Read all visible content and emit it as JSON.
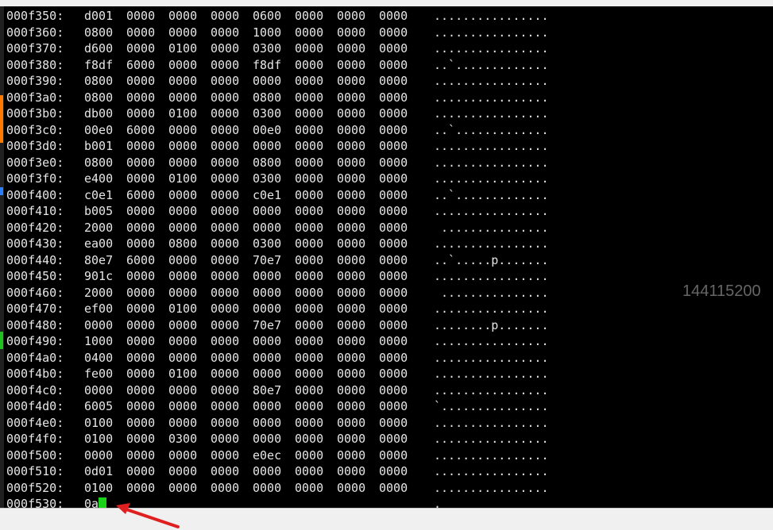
{
  "colors": {
    "background": "#000000",
    "text": "#e6e6e6",
    "cursor": "#19d219",
    "arrow": "#e02020",
    "side_value": "#666666"
  },
  "hexdump": {
    "rows": [
      {
        "addr": "000f350:",
        "hex": [
          "d001",
          "0000",
          "0000",
          "0000",
          "0600",
          "0000",
          "0000",
          "0000"
        ],
        "ascii": "................"
      },
      {
        "addr": "000f360:",
        "hex": [
          "0800",
          "0000",
          "0000",
          "0000",
          "1000",
          "0000",
          "0000",
          "0000"
        ],
        "ascii": "................"
      },
      {
        "addr": "000f370:",
        "hex": [
          "d600",
          "0000",
          "0100",
          "0000",
          "0300",
          "0000",
          "0000",
          "0000"
        ],
        "ascii": "................"
      },
      {
        "addr": "000f380:",
        "hex": [
          "f8df",
          "6000",
          "0000",
          "0000",
          "f8df",
          "0000",
          "0000",
          "0000"
        ],
        "ascii": "..`............."
      },
      {
        "addr": "000f390:",
        "hex": [
          "0800",
          "0000",
          "0000",
          "0000",
          "0000",
          "0000",
          "0000",
          "0000"
        ],
        "ascii": "................"
      },
      {
        "addr": "000f3a0:",
        "hex": [
          "0800",
          "0000",
          "0000",
          "0000",
          "0800",
          "0000",
          "0000",
          "0000"
        ],
        "ascii": "................"
      },
      {
        "addr": "000f3b0:",
        "hex": [
          "db00",
          "0000",
          "0100",
          "0000",
          "0300",
          "0000",
          "0000",
          "0000"
        ],
        "ascii": "................"
      },
      {
        "addr": "000f3c0:",
        "hex": [
          "00e0",
          "6000",
          "0000",
          "0000",
          "00e0",
          "0000",
          "0000",
          "0000"
        ],
        "ascii": "..`............."
      },
      {
        "addr": "000f3d0:",
        "hex": [
          "b001",
          "0000",
          "0000",
          "0000",
          "0000",
          "0000",
          "0000",
          "0000"
        ],
        "ascii": "................"
      },
      {
        "addr": "000f3e0:",
        "hex": [
          "0800",
          "0000",
          "0000",
          "0000",
          "0800",
          "0000",
          "0000",
          "0000"
        ],
        "ascii": "................"
      },
      {
        "addr": "000f3f0:",
        "hex": [
          "e400",
          "0000",
          "0100",
          "0000",
          "0300",
          "0000",
          "0000",
          "0000"
        ],
        "ascii": "................"
      },
      {
        "addr": "000f400:",
        "hex": [
          "c0e1",
          "6000",
          "0000",
          "0000",
          "c0e1",
          "0000",
          "0000",
          "0000"
        ],
        "ascii": "..`............."
      },
      {
        "addr": "000f410:",
        "hex": [
          "b005",
          "0000",
          "0000",
          "0000",
          "0000",
          "0000",
          "0000",
          "0000"
        ],
        "ascii": "................"
      },
      {
        "addr": "000f420:",
        "hex": [
          "2000",
          "0000",
          "0000",
          "0000",
          "0000",
          "0000",
          "0000",
          "0000"
        ],
        "ascii": " ..............."
      },
      {
        "addr": "000f430:",
        "hex": [
          "ea00",
          "0000",
          "0800",
          "0000",
          "0300",
          "0000",
          "0000",
          "0000"
        ],
        "ascii": "................"
      },
      {
        "addr": "000f440:",
        "hex": [
          "80e7",
          "6000",
          "0000",
          "0000",
          "70e7",
          "0000",
          "0000",
          "0000"
        ],
        "ascii": "..`.....p......."
      },
      {
        "addr": "000f450:",
        "hex": [
          "901c",
          "0000",
          "0000",
          "0000",
          "0000",
          "0000",
          "0000",
          "0000"
        ],
        "ascii": "................"
      },
      {
        "addr": "000f460:",
        "hex": [
          "2000",
          "0000",
          "0000",
          "0000",
          "0000",
          "0000",
          "0000",
          "0000"
        ],
        "ascii": " ..............."
      },
      {
        "addr": "000f470:",
        "hex": [
          "ef00",
          "0000",
          "0100",
          "0000",
          "0000",
          "0000",
          "0000",
          "0000"
        ],
        "ascii": "................"
      },
      {
        "addr": "000f480:",
        "hex": [
          "0000",
          "0000",
          "0000",
          "0000",
          "70e7",
          "0000",
          "0000",
          "0000"
        ],
        "ascii": "........p......."
      },
      {
        "addr": "000f490:",
        "hex": [
          "1000",
          "0000",
          "0000",
          "0000",
          "0000",
          "0000",
          "0000",
          "0000"
        ],
        "ascii": "................"
      },
      {
        "addr": "000f4a0:",
        "hex": [
          "0400",
          "0000",
          "0000",
          "0000",
          "0000",
          "0000",
          "0000",
          "0000"
        ],
        "ascii": "................"
      },
      {
        "addr": "000f4b0:",
        "hex": [
          "fe00",
          "0000",
          "0100",
          "0000",
          "0000",
          "0000",
          "0000",
          "0000"
        ],
        "ascii": "................"
      },
      {
        "addr": "000f4c0:",
        "hex": [
          "0000",
          "0000",
          "0000",
          "0000",
          "80e7",
          "0000",
          "0000",
          "0000"
        ],
        "ascii": "................"
      },
      {
        "addr": "000f4d0:",
        "hex": [
          "6005",
          "0000",
          "0000",
          "0000",
          "0000",
          "0000",
          "0000",
          "0000"
        ],
        "ascii": "`..............."
      },
      {
        "addr": "000f4e0:",
        "hex": [
          "0100",
          "0000",
          "0000",
          "0000",
          "0000",
          "0000",
          "0000",
          "0000"
        ],
        "ascii": "................"
      },
      {
        "addr": "000f4f0:",
        "hex": [
          "0100",
          "0000",
          "0300",
          "0000",
          "0000",
          "0000",
          "0000",
          "0000"
        ],
        "ascii": "................"
      },
      {
        "addr": "000f500:",
        "hex": [
          "0000",
          "0000",
          "0000",
          "0000",
          "e0ec",
          "0000",
          "0000",
          "0000"
        ],
        "ascii": "................"
      },
      {
        "addr": "000f510:",
        "hex": [
          "0d01",
          "0000",
          "0000",
          "0000",
          "0000",
          "0000",
          "0000",
          "0000"
        ],
        "ascii": "................"
      },
      {
        "addr": "000f520:",
        "hex": [
          "0100",
          "0000",
          "0000",
          "0000",
          "0000",
          "0000",
          "0000",
          "0000"
        ],
        "ascii": "................"
      }
    ],
    "last_row": {
      "addr": "000f530:",
      "hex": "0a",
      "ascii": "."
    }
  },
  "side_value": "144115200"
}
